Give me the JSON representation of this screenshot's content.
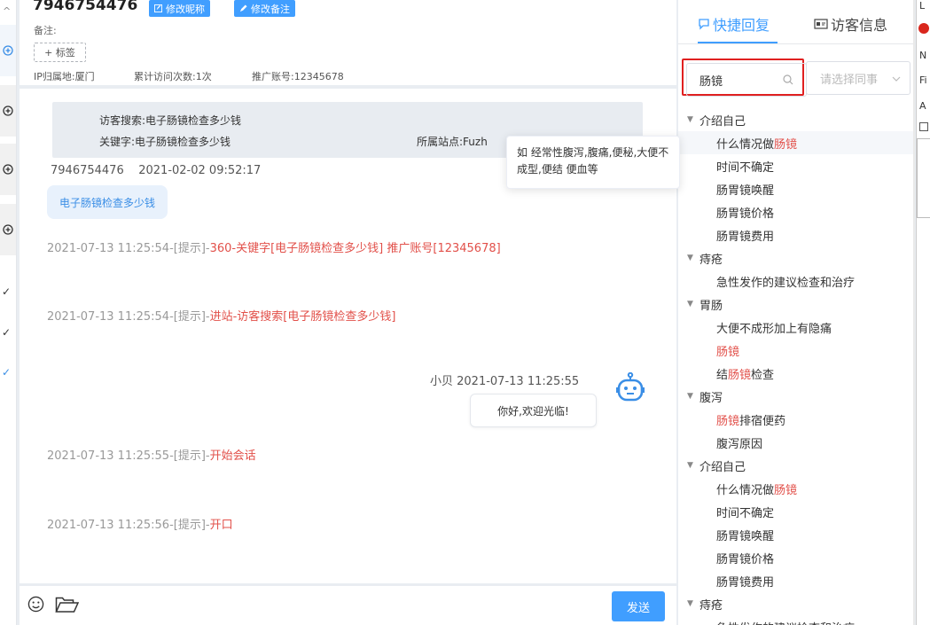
{
  "header": {
    "title": "7946754476",
    "btn_edit_nickname": "修改昵称",
    "btn_edit_remark": "修改备注",
    "remark_label": "备注:",
    "tag_button": "+ 标签",
    "ip_location": "IP归属地:厦门",
    "visit_count": "累计访问次数:1次",
    "promo_account": "推广账号:12345678"
  },
  "chat": {
    "info": {
      "visitor_search": "访客搜索:电子肠镜检查多少钱",
      "keyword": "关键字:电子肠镜检查多少钱",
      "site": "所属站点:Fuzh"
    },
    "visitor_meta": "7946754476    2021-02-02 09:52:17",
    "visitor_bubble": "电子肠镜检查多少钱",
    "system_msgs": [
      {
        "prefix": "2021-07-13 11:25:54-[提示]-",
        "red": "360-关键字[电子肠镜检查多少钱] 推广账号[12345678]"
      },
      {
        "prefix": "2021-07-13 11:25:54-[提示]-",
        "red": "进站-访客搜索[电子肠镜检查多少钱]"
      },
      {
        "prefix": "2021-07-13 11:25:55-[提示]-",
        "red": "开始会话"
      },
      {
        "prefix": "2021-07-13 11:25:56-[提示]-",
        "red": "开口"
      }
    ],
    "agent_meta": "小贝 2021-07-13 11:25:55",
    "agent_bubble": "你好,欢迎光临!"
  },
  "tooltip": {
    "text": "如 经常性腹泻,腹痛,便秘,大便不成型,便结 便血等"
  },
  "input_bar": {
    "send_label": "发送"
  },
  "right_panel": {
    "tab_quick_reply": "快捷回复",
    "tab_visitor_info": "访客信息",
    "search_value": "肠镜",
    "colleague_placeholder": "请选择同事",
    "tree": [
      {
        "type": "group",
        "label": "介绍自己"
      },
      {
        "type": "item",
        "pre": "什么情况做",
        "hl": "肠镜",
        "post": ""
      },
      {
        "type": "item",
        "pre": "时间不确定",
        "hl": "",
        "post": ""
      },
      {
        "type": "item",
        "pre": "肠胃镜唤醒",
        "hl": "",
        "post": ""
      },
      {
        "type": "item",
        "pre": "肠胃镜价格",
        "hl": "",
        "post": ""
      },
      {
        "type": "item",
        "pre": "肠胃镜费用",
        "hl": "",
        "post": ""
      },
      {
        "type": "group",
        "label": "痔疮"
      },
      {
        "type": "item",
        "pre": "急性发作的建议检查和治疗",
        "hl": "",
        "post": ""
      },
      {
        "type": "group",
        "label": "胃肠"
      },
      {
        "type": "item",
        "pre": "大便不成形加上有隐痛",
        "hl": "",
        "post": ""
      },
      {
        "type": "item",
        "pre": "",
        "hl": "肠镜",
        "post": ""
      },
      {
        "type": "item",
        "pre": "结",
        "hl": "肠镜",
        "post": "检查"
      },
      {
        "type": "group",
        "label": "腹泻"
      },
      {
        "type": "item",
        "pre": "",
        "hl": "肠镜",
        "post": "排宿便药"
      },
      {
        "type": "item",
        "pre": "腹泻原因",
        "hl": "",
        "post": ""
      },
      {
        "type": "group",
        "label": "介绍自己"
      },
      {
        "type": "item",
        "pre": "什么情况做",
        "hl": "肠镜",
        "post": ""
      },
      {
        "type": "item",
        "pre": "时间不确定",
        "hl": "",
        "post": ""
      },
      {
        "type": "item",
        "pre": "肠胃镜唤醒",
        "hl": "",
        "post": ""
      },
      {
        "type": "item",
        "pre": "肠胃镜价格",
        "hl": "",
        "post": ""
      },
      {
        "type": "item",
        "pre": "肠胃镜费用",
        "hl": "",
        "post": ""
      },
      {
        "type": "group",
        "label": "痔疮"
      },
      {
        "type": "item",
        "pre": "急性发作的建议检查和治疗",
        "hl": "",
        "post": ""
      }
    ]
  },
  "far_right": {
    "labels": [
      "L",
      "N",
      "Fi",
      "A"
    ]
  },
  "colors": {
    "accent": "#409eff",
    "highlight_red": "#e2504a",
    "focus_border": "#e02020"
  }
}
